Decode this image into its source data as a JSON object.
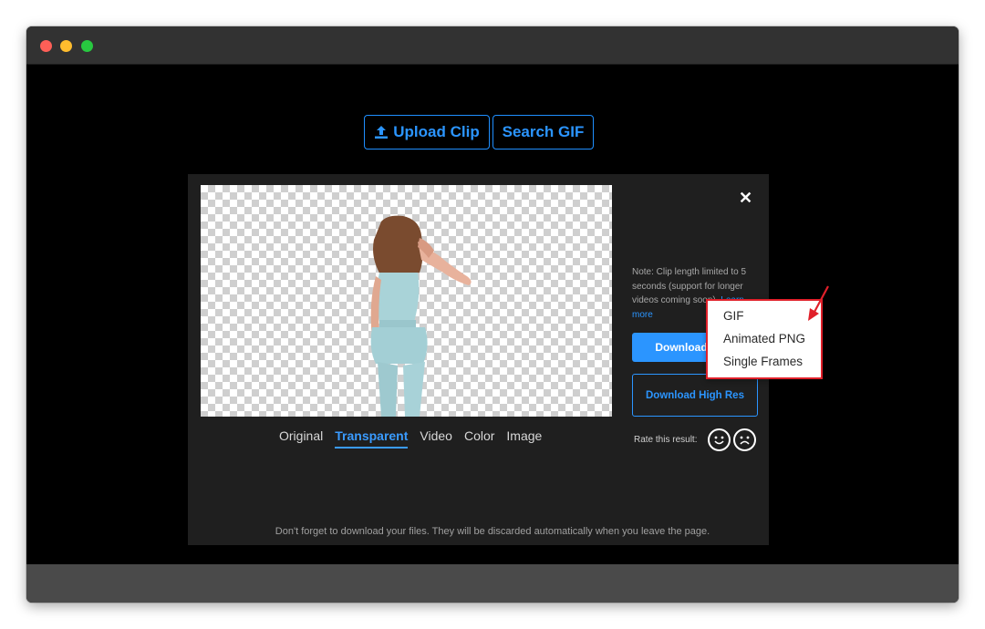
{
  "toolbar": {
    "upload_label": "Upload Clip",
    "search_label": "Search GIF"
  },
  "tabs": [
    {
      "label": "Original",
      "active": false
    },
    {
      "label": "Transparent",
      "active": true
    },
    {
      "label": "Video",
      "active": false
    },
    {
      "label": "Color",
      "active": false
    },
    {
      "label": "Image",
      "active": false
    }
  ],
  "side": {
    "note_text": "Note: Clip length limited to 5 seconds (support for longer videos coming soon).",
    "learn_more": "Learn more",
    "download_label": "Download",
    "download_hi_label": "Download High Res",
    "rate_label": "Rate this result:"
  },
  "dropdown": {
    "items": [
      "GIF",
      "Animated PNG",
      "Single Frames"
    ]
  },
  "footer": {
    "note": "Don't forget to download your files. They will be discarded automatically when you leave the page."
  },
  "colors": {
    "accent": "#2b95ff",
    "highlight_box": "#e0202a",
    "arrow": "#e0202a"
  },
  "icons": {
    "upload": "upload-icon",
    "close": "close-icon",
    "caret": "caret-down-icon",
    "smile": "smile-icon",
    "frown": "frown-icon"
  }
}
